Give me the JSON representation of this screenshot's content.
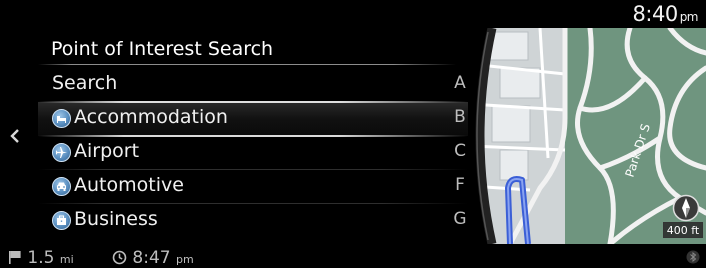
{
  "status": {
    "time": "8:40",
    "ampm": "pm"
  },
  "panel": {
    "title": "Point of Interest Search",
    "items": [
      {
        "label": "Search",
        "icon": null
      },
      {
        "label": "Accommodation",
        "icon": "bed-icon",
        "selected": true
      },
      {
        "label": "Airport",
        "icon": "airplane-icon"
      },
      {
        "label": "Automotive",
        "icon": "car-icon"
      },
      {
        "label": "Business",
        "icon": "briefcase-icon"
      }
    ],
    "index": [
      "A",
      "B",
      "C",
      "F",
      "G"
    ]
  },
  "map": {
    "street_label": "Park Dr S",
    "scale": "400 ft"
  },
  "bottom": {
    "distance": "1.5",
    "distance_unit": "mi",
    "eta": "8:47",
    "eta_unit": "pm"
  },
  "colors": {
    "accent": "#5a8fc0",
    "map_land": "#6f957f",
    "map_road": "#f2f2f2",
    "route": "#3b5fd6"
  }
}
